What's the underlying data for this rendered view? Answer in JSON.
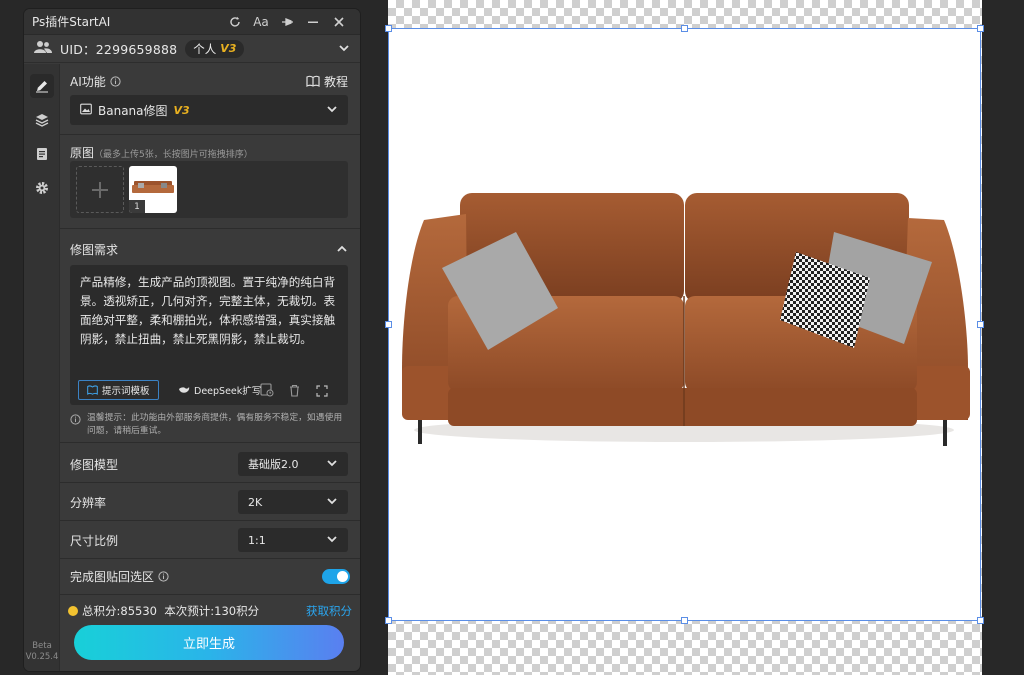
{
  "plugin": {
    "title": "Ps插件StartAI",
    "font_label": "Aa",
    "uid_text": "UID：2299659888",
    "plan_label": "个人",
    "plan_version": "V3",
    "version_label": "Beta",
    "version_number": "V0.25.4"
  },
  "ai_function": {
    "label": "AI功能",
    "tutorial_label": "教程",
    "selected": "Banana修图",
    "selected_version": "V3"
  },
  "source_image": {
    "label": "原图",
    "hint": "（最多上传5张，长按图片可拖拽排序）",
    "thumb_index": "1"
  },
  "edit_request": {
    "label": "修图需求",
    "text": "产品精修，生成产品的顶视图。置于纯净的纯白背景。透视矫正，几何对齐，完整主体，无裁切。表面绝对平整，柔和棚拍光，体积感增强，真实接触阴影，禁止扭曲，禁止死黑阴影，禁止裁切。",
    "template_button": "提示词模板",
    "deepseek_button": "DeepSeek扩写"
  },
  "notice": "温馨提示：此功能由外部服务商提供，偶有服务不稳定，如遇使用问题，请稍后重试。",
  "settings": {
    "model_label": "修图模型",
    "model_value": "基础版2.0",
    "resolution_label": "分辨率",
    "resolution_value": "2K",
    "ratio_label": "尺寸比例",
    "ratio_value": "1:1",
    "paste_back_label": "完成图贴回选区",
    "paste_back_on": true
  },
  "points": {
    "summary": "总积分:85530  本次预计:130积分",
    "get_points": "获取积分"
  },
  "generate_button": "立即生成",
  "colors": {
    "accent": "#1ea4e9",
    "badge": "#e8b020",
    "gradient_start": "#18d0d8",
    "gradient_end": "#5a7ff0"
  }
}
